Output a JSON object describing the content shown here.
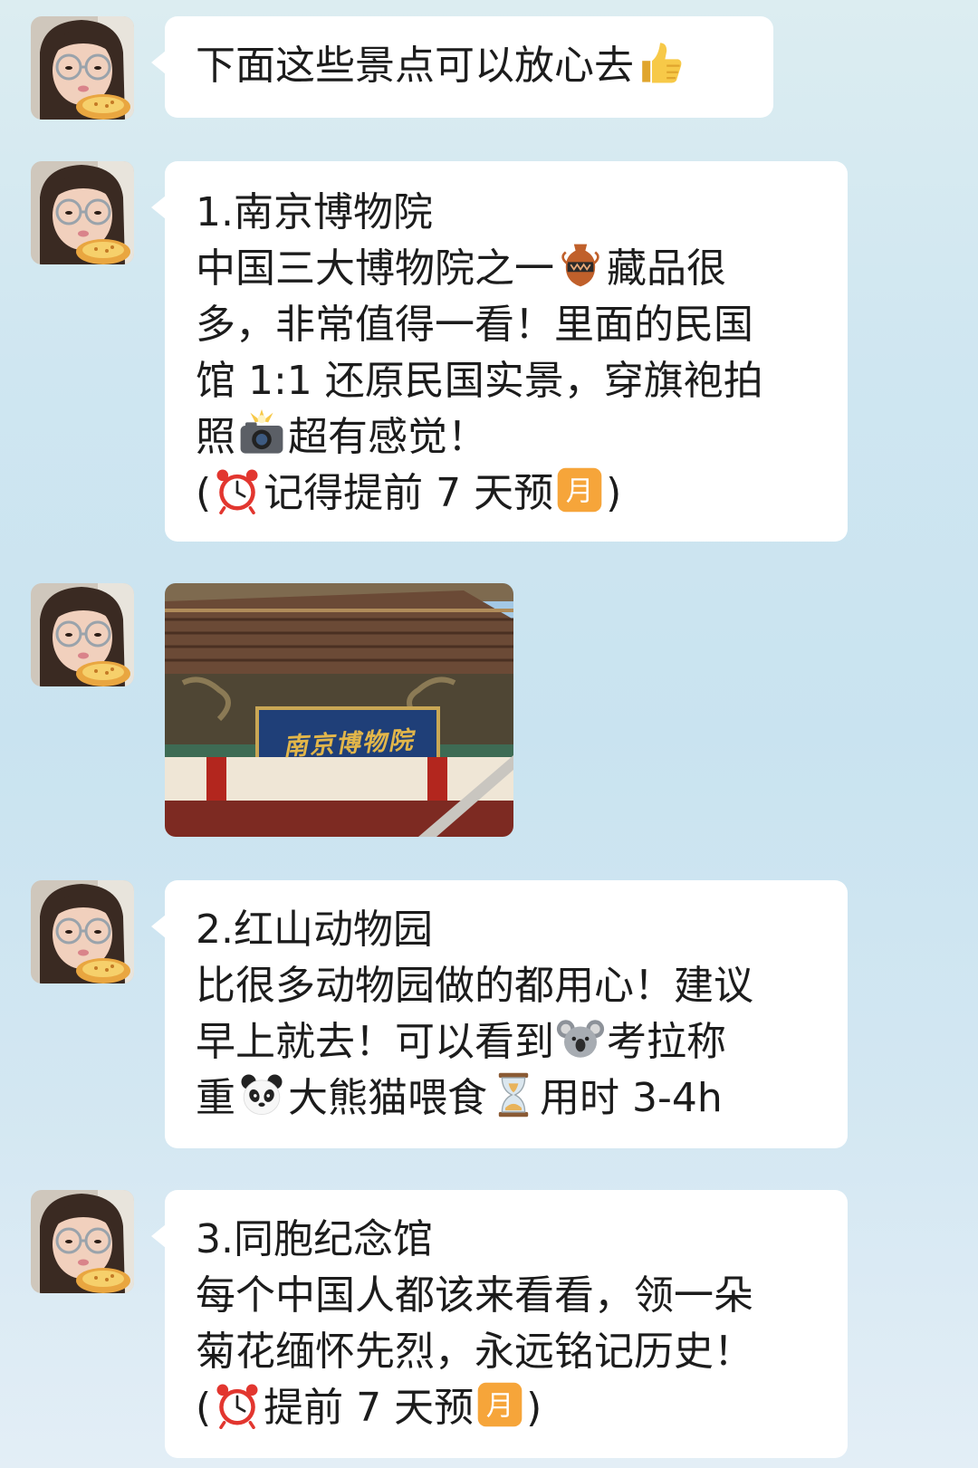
{
  "messages": [
    {
      "type": "text",
      "lines": [
        "下面这些景点可以放心去"
      ],
      "emoji_after": "thumbs-up"
    },
    {
      "type": "text",
      "lines": [
        "1.南京博物院",
        "中国三大博物院之一",
        "藏品很",
        "多，非常值得一看！里面的民国",
        "馆 1:1 还原民国实景，穿旗袍拍",
        "照",
        "超有感觉！",
        "(",
        "记得提前 7 天预",
        ")"
      ]
    },
    {
      "type": "image",
      "sign_text": "南京博物院"
    },
    {
      "type": "text",
      "lines": [
        "2.红山动物园",
        "比很多动物园做的都用心！建议",
        "早上就去！可以看到",
        "考拉称",
        "重",
        "大熊猫喂食",
        "用时 3-4h"
      ]
    },
    {
      "type": "text",
      "lines": [
        "3.同胞纪念馆",
        "每个中国人都该来看看，领一朵",
        "菊花缅怀先烈，永远铭记历史！",
        "(",
        "提前 7 天预",
        ")"
      ]
    }
  ],
  "emoji_icons": [
    "thumbs-up",
    "amphora",
    "camera-flash",
    "alarm-clock",
    "month-button",
    "koala",
    "panda",
    "hourglass"
  ],
  "month_badge_char": "月",
  "colors": {
    "bubble": "#ffffff",
    "text": "#1c1c1c",
    "background_top": "#dcedf1",
    "background_bottom": "#e3eef6",
    "month_badge": "#f6a53a"
  }
}
